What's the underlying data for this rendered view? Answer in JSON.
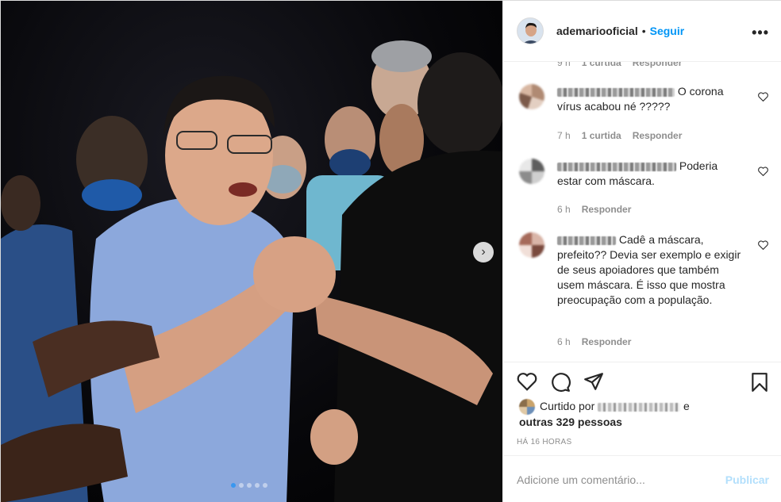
{
  "post": {
    "photo_description_icon": "photo-carousel",
    "carousel": {
      "current": 1,
      "total": 5
    }
  },
  "header": {
    "username": "ademariooficial",
    "separator": "•",
    "follow_label": "Seguir",
    "more_label": "•••"
  },
  "comments": {
    "partial_prev": {
      "time": "9 h",
      "likes": "1 curtida",
      "reply": "Responder"
    },
    "items": [
      {
        "text": "O corona vírus acabou né ?????",
        "time": "7 h",
        "likes": "1 curtida",
        "reply": "Responder"
      },
      {
        "text": "Poderia estar com máscara.",
        "time": "6 h",
        "likes": "",
        "reply": "Responder"
      },
      {
        "text": "Cadê a máscara, prefeito?? Devia ser exemplo e exigir de seus apoiadores que também usem máscara. É isso que mostra preocupação com a população.",
        "time": "6 h",
        "likes": "",
        "reply": "Responder"
      }
    ]
  },
  "actions": {
    "liked_prefix": "Curtido por",
    "liked_and": "e",
    "liked_others": "outras 329 pessoas",
    "timestamp": "HÁ 16 HORAS"
  },
  "composer": {
    "placeholder": "Adicione um comentário...",
    "publish_label": "Publicar"
  },
  "colors": {
    "accent": "#0095f6",
    "publish_disabled": "#b2dffc",
    "muted": "#8e8e8e"
  }
}
